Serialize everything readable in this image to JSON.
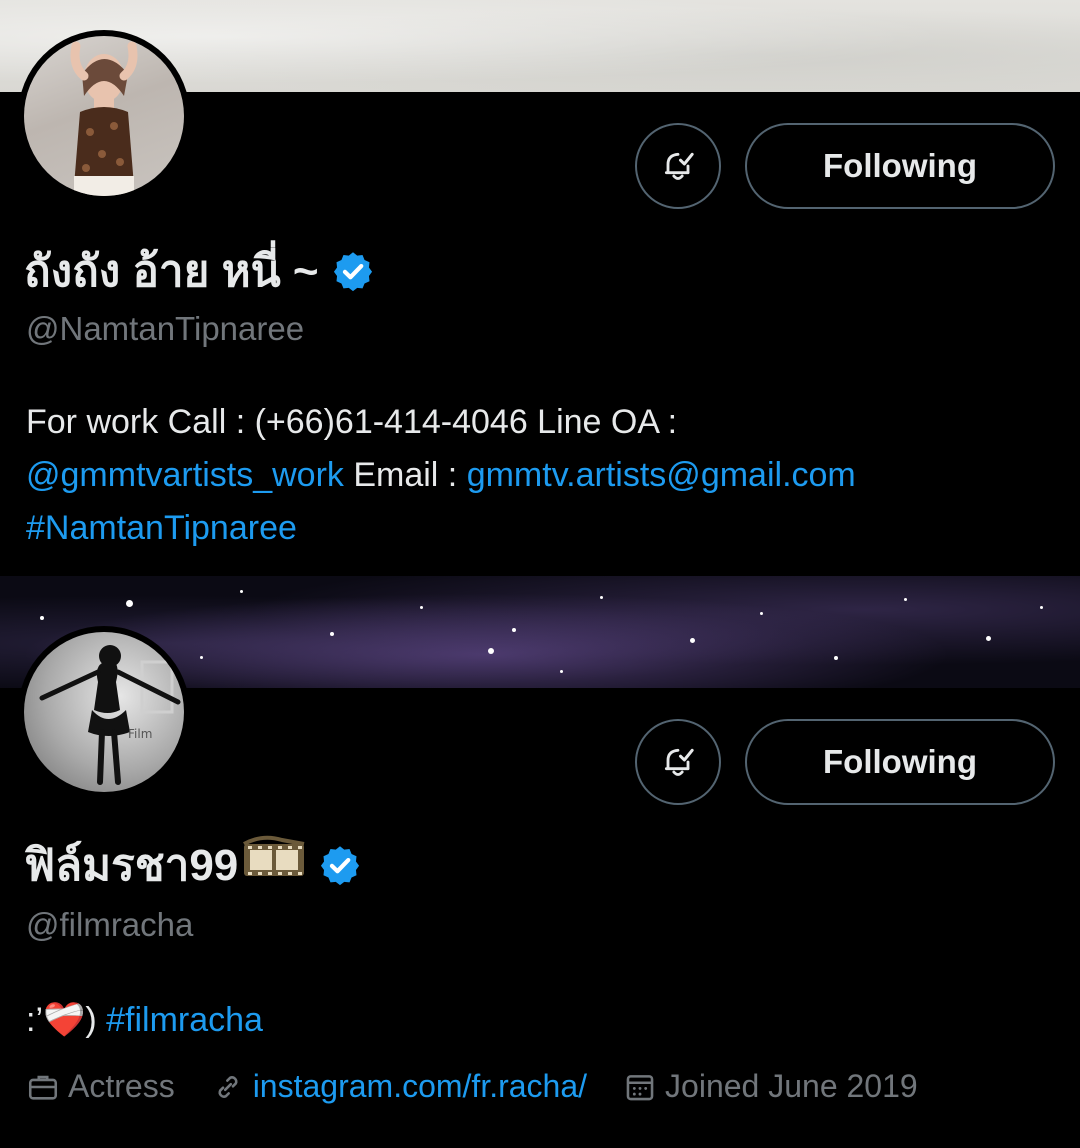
{
  "profiles": [
    {
      "display_name": "ถังถัง อ้าย หนี่ ~",
      "handle": "@NamtanTipnaree",
      "verified": true,
      "follow_button_label": "Following",
      "bio": {
        "text1": "For work Call : (+66)61-414-4046 Line OA :",
        "mention": "@gmmtvartists_work",
        "text2": " Email : ",
        "email": "gmmtv.artists@gmail.com",
        "hashtag": "#NamtanTipnaree"
      }
    },
    {
      "display_name": "ฟิล์มรชา99",
      "name_emoji": "film-frames-emoji",
      "handle": "@filmracha",
      "verified": true,
      "follow_button_label": "Following",
      "bio": {
        "prefix": ":’",
        "emoji": "❤️‍🩹",
        "suffix": ") ",
        "hashtag": "#filmracha"
      },
      "meta": {
        "category": "Actress",
        "link": "instagram.com/fr.racha/",
        "joined": "Joined June 2019"
      }
    }
  ],
  "icons": {
    "bell": "notification-bell-check-icon",
    "verified": "verified-badge-icon",
    "briefcase": "briefcase-icon",
    "link": "link-icon",
    "calendar": "calendar-icon"
  },
  "colors": {
    "background": "#000000",
    "text": "#e7e9ea",
    "secondary": "#71767b",
    "accent": "#1d9bf0",
    "border": "#536471"
  }
}
